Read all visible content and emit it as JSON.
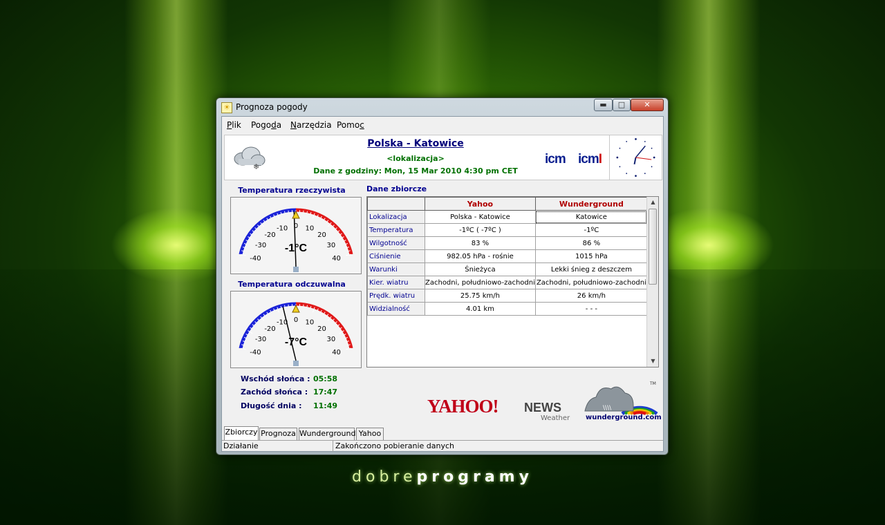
{
  "window": {
    "title": "Prognoza pogody",
    "minimize_label": "▬",
    "maximize_label": "□",
    "close_label": "✕"
  },
  "menu": [
    {
      "label": "Plik",
      "hotkey_index": 0
    },
    {
      "label": "Pogoda",
      "hotkey_index": 4
    },
    {
      "label": "Narzędzia",
      "hotkey_index": 0
    },
    {
      "label": "Pomoc",
      "hotkey_index": 4
    }
  ],
  "header": {
    "location": "Polska - Katowice",
    "sublabel": "<lokalizacja>",
    "timestamp": "Dane z godziny: Mon, 15 Mar 2010 4:30 pm CET",
    "icm_logo_text": "icm"
  },
  "gauges": {
    "real": {
      "title": "Temperatura rzeczywista",
      "value_label": "-1°C",
      "value": -1,
      "ticks": [
        "-40",
        "-30",
        "-20",
        "-10",
        "0",
        "10",
        "20",
        "30",
        "40"
      ]
    },
    "feel": {
      "title": "Temperatura odczuwalna",
      "value_label": "-7°C",
      "value": -7,
      "ticks": [
        "-40",
        "-30",
        "-20",
        "-10",
        "0",
        "10",
        "20",
        "30",
        "40"
      ]
    }
  },
  "sun": {
    "sunrise_label": "Wschód słońca :",
    "sunrise": "05:58",
    "sunset_label": "Zachód słońca :",
    "sunset": "17:47",
    "daylength_label": "Długość dnia :",
    "daylength": "11:49"
  },
  "summary": {
    "title": "Dane zbiorcze",
    "columns": [
      "Yahoo",
      "Wunderground"
    ],
    "rows": [
      {
        "label": "Lokalizacja",
        "yahoo": "Polska - Katowice",
        "wu": "Katowice"
      },
      {
        "label": "Temperatura",
        "yahoo": "-1ºC  ( -7ºC )",
        "wu": "-1ºC"
      },
      {
        "label": "Wilgotność",
        "yahoo": "83 %",
        "wu": "86 %"
      },
      {
        "label": "Ciśnienie",
        "yahoo": "982.05 hPa - rośnie",
        "wu": "1015 hPa"
      },
      {
        "label": "Warunki",
        "yahoo": "Śnieżyca",
        "wu": "Lekki śnieg z deszczem"
      },
      {
        "label": "Kier. wiatru",
        "yahoo": "Zachodni, południowo-zachodni",
        "wu": "Zachodni, południowo-zachodni"
      },
      {
        "label": "Prędk. wiatru",
        "yahoo": "25.75 km/h",
        "wu": "26 km/h"
      },
      {
        "label": "Widzialność",
        "yahoo": "4.01 km",
        "wu": "- - -"
      }
    ]
  },
  "logos": {
    "yahoo": "YAHOO!",
    "news": "NEWS",
    "weather": "Weather",
    "wunderground": "wunderground.com",
    "tm": "TM"
  },
  "tabs": [
    "Zbiorczy",
    "Prognoza",
    "Wunderground",
    "Yahoo"
  ],
  "status": {
    "left": "Działanie",
    "right": "Zakończono pobieranie danych"
  },
  "desktop": {
    "brand_light": "dobre",
    "brand_bold": "programy"
  },
  "colors": {
    "accent_blue": "#000090",
    "value_green": "#007000",
    "header_red": "#b00000",
    "desktop_green": "#2f6a05"
  }
}
